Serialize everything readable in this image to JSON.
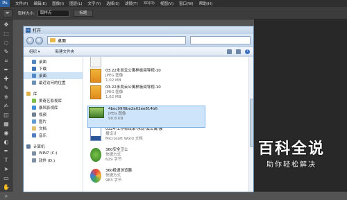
{
  "ps": {
    "logo": "Ps",
    "menu": [
      "文件(F)",
      "编辑(E)",
      "图像(I)",
      "图层(L)",
      "文字(Y)",
      "选择(S)",
      "滤镜(T)",
      "3D(D)",
      "视图(V)",
      "窗口(W)",
      "帮助(H)"
    ],
    "options": {
      "sample_size_label": "取样大小:",
      "sample_size_value": "取样点",
      "button_label": "标题"
    },
    "tool_icons": [
      "move-icon",
      "marquee-icon",
      "lasso-icon",
      "quick-select-icon",
      "crop-icon",
      "eyedropper-icon",
      "heal-icon",
      "brush-icon",
      "stamp-icon",
      "history-brush-icon",
      "eraser-icon",
      "gradient-icon",
      "blur-icon",
      "dodge-icon",
      "pen-icon",
      "type-icon",
      "path-select-icon",
      "shape-icon",
      "hand-icon",
      "zoom-icon"
    ],
    "tool_glyphs": [
      "✥",
      "⬚",
      "◌",
      "✎",
      "⌗",
      "✒",
      "✚",
      "✎",
      "⎈",
      "✍",
      "◫",
      "▦",
      "◉",
      "◐",
      "✒",
      "T",
      "➤",
      "▭",
      "✋",
      "⌕"
    ]
  },
  "dialog": {
    "title": "打开",
    "address": "桌面",
    "toolbar": {
      "organize": "组织 ▾",
      "new_folder": "新建文件夹"
    },
    "nav": [
      {
        "label": "桌面",
        "type": "item",
        "color": "#4f86c6"
      },
      {
        "label": "下载",
        "type": "item",
        "color": "#3d74b8"
      },
      {
        "label": "桌面",
        "type": "item",
        "selected": true,
        "color": "#4f86c6"
      },
      {
        "label": "最近访问的位置",
        "type": "item",
        "color": "#6a8fb5"
      },
      {
        "type": "gap"
      },
      {
        "label": "库",
        "type": "group",
        "color": "#e0b24a"
      },
      {
        "label": "爱奇艺影视库",
        "type": "item",
        "color": "#7cc04b"
      },
      {
        "label": "暴风影视库",
        "type": "item",
        "color": "#3f8fd8"
      },
      {
        "label": "视频",
        "type": "item",
        "color": "#6f7f91"
      },
      {
        "label": "图片",
        "type": "item",
        "color": "#5f9bd0"
      },
      {
        "label": "文档",
        "type": "item",
        "color": "#e0c06a"
      },
      {
        "label": "音乐",
        "type": "item",
        "color": "#4f7fc0"
      },
      {
        "type": "gap"
      },
      {
        "label": "计算机",
        "type": "group",
        "color": "#5d7898"
      },
      {
        "label": "WIN7 (C:)",
        "type": "item",
        "color": "#7c8ea3"
      },
      {
        "label": "软件 (D:)",
        "type": "item",
        "color": "#7c8ea3"
      }
    ],
    "files": [
      {
        "name": "",
        "type_label": "680 字节",
        "size": "",
        "thumb": "doc"
      },
      {
        "name": "03.22永尚云公寓样板间导视-10",
        "type_label": "JPEG 图像",
        "size": "1.02 MB",
        "thumb": "orange"
      },
      {
        "name": "03.22永尚云公寓样板间导视-10",
        "type_label": "JPEG 图像",
        "size": "1.62 MB",
        "thumb": "orange"
      },
      {
        "name": "4bec99f9be2a02ee814b6",
        "type_label": "JPEG 图像",
        "size": "90.8 KB",
        "thumb": "green",
        "selected": true
      },
      {
        "name": "0324-工作修改单-永尚-云公寓-展",
        "type_label": "报设计",
        "size": "Microsoft Word 文档",
        "thumb": "word"
      },
      {
        "name": "360安全卫士",
        "type_label": "快捷方式",
        "size": "629 字节",
        "thumb": "shield"
      },
      {
        "name": "360极速浏览器",
        "type_label": "快捷方式",
        "size": "983 字节",
        "thumb": "browser"
      }
    ]
  },
  "watermark": {
    "title": "百科全说",
    "subtitle": "助你轻松解决"
  }
}
